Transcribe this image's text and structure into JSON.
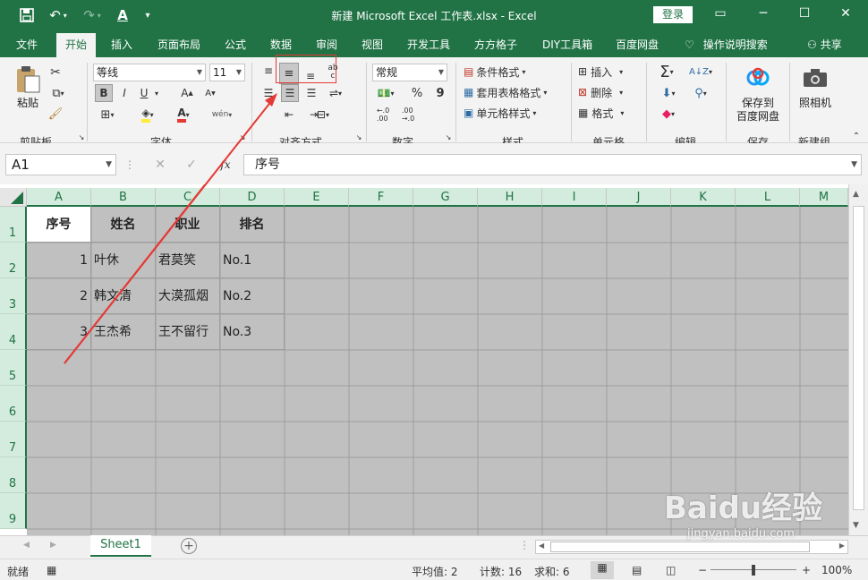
{
  "window": {
    "title": "新建 Microsoft Excel 工作表.xlsx  -  Excel",
    "login_label": "登录",
    "qat_icons": [
      "save-icon",
      "undo-icon",
      "redo-icon",
      "font-color-icon",
      "customize-icon"
    ],
    "controls": [
      "▭",
      "─",
      "☐",
      "✕"
    ]
  },
  "ribbon_tabs": [
    "文件",
    "开始",
    "插入",
    "页面布局",
    "公式",
    "数据",
    "审阅",
    "视图",
    "开发工具",
    "方方格子",
    "DIY工具箱",
    "百度网盘",
    "操作说明搜索",
    "共享"
  ],
  "active_tab": "开始",
  "ribbon": {
    "clipboard": {
      "paste": "粘贴",
      "group": "剪贴板"
    },
    "font": {
      "name": "等线",
      "size": "11",
      "group": "字体",
      "bold": "B",
      "italic": "I",
      "underline": "U"
    },
    "alignment": {
      "group": "对齐方式"
    },
    "number": {
      "format": "常规",
      "group": "数字",
      "percent": "%",
      "comma": "9"
    },
    "styles": {
      "conditional": "条件格式",
      "table": "套用表格格式",
      "cell": "单元格样式",
      "group": "样式"
    },
    "cells": {
      "insert": "插入",
      "delete": "删除",
      "format": "格式",
      "group": "单元格"
    },
    "editing": {
      "group": "编辑"
    },
    "save": {
      "label1": "保存到",
      "label2": "百度网盘",
      "group": "保存"
    },
    "camera": {
      "label": "照相机",
      "group": "新建组"
    }
  },
  "formula_bar": {
    "name_box": "A1",
    "fx": "fx",
    "content": "序号"
  },
  "columns": [
    "A",
    "B",
    "C",
    "D",
    "E",
    "F",
    "G",
    "H",
    "I",
    "J",
    "K",
    "L",
    "M"
  ],
  "rows": [
    "1",
    "2",
    "3",
    "4",
    "5",
    "6",
    "7",
    "8",
    "9"
  ],
  "table": {
    "header": [
      "序号",
      "姓名",
      "职业",
      "排名"
    ],
    "rows": [
      [
        "1",
        "叶休",
        "君莫笑",
        "No.1"
      ],
      [
        "2",
        "韩文清",
        "大漠孤烟",
        "No.2"
      ],
      [
        "3",
        "王杰希",
        "王不留行",
        "No.3"
      ]
    ]
  },
  "sheet_tab": "Sheet1",
  "status": {
    "ready": "就绪",
    "average": "平均值: 2",
    "count": "计数: 16",
    "sum": "求和: 6",
    "zoom": "100%"
  },
  "watermark": {
    "line1": "Baidu经验",
    "line2": "jingyan.baidu.com"
  },
  "colors": {
    "excel_green": "#217346",
    "annotation_red": "#e53935",
    "selection_gray": "#c0c0c0"
  }
}
